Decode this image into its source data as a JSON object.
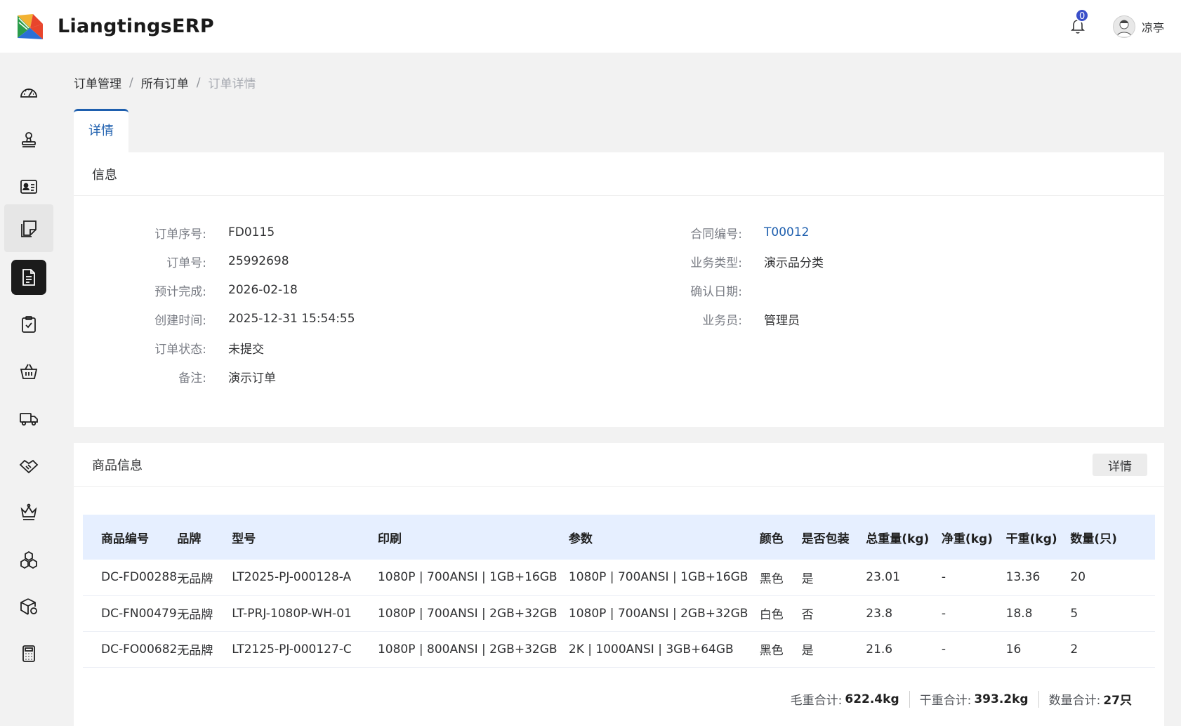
{
  "app": {
    "title": "LiangtingsERP"
  },
  "header": {
    "notification_count": "0",
    "username": "凉亭"
  },
  "breadcrumb": [
    "订单管理",
    "所有订单",
    "订单详情"
  ],
  "tabs": [
    {
      "label": "详情"
    }
  ],
  "info_card": {
    "title": "信息",
    "left": [
      {
        "label": "订单序号:",
        "value": "FD0115"
      },
      {
        "label": "订单号:",
        "value": "25992698"
      },
      {
        "label": "预计完成:",
        "value": "2026-02-18"
      },
      {
        "label": "创建时间:",
        "value": "2025-12-31 15:54:55"
      },
      {
        "label": "订单状态:",
        "value": "未提交"
      },
      {
        "label": "备注:",
        "value": "演示订单"
      }
    ],
    "right": [
      {
        "label": "合同编号:",
        "value": "T00012"
      },
      {
        "label": "业务类型:",
        "value": "演示品分类"
      },
      {
        "label": "确认日期:",
        "value": ""
      },
      {
        "label": "业务员:",
        "value": "管理员"
      }
    ]
  },
  "goods_card": {
    "title": "商品信息",
    "detail_button": "详情",
    "columns": [
      "商品编号",
      "品牌",
      "型号",
      "印刷",
      "参数",
      "颜色",
      "是否包装",
      "总重量(kg)",
      "净重(kg)",
      "干重(kg)",
      "数量(只)"
    ],
    "rows": [
      [
        "DC-FD00288",
        "无品牌",
        "LT2025-PJ-000128-A",
        "1080P | 700ANSI | 1GB+16GB",
        "1080P | 700ANSI | 1GB+16GB",
        "黑色",
        "是",
        "23.01",
        "-",
        "13.36",
        "20"
      ],
      [
        "DC-FN00479",
        "无品牌",
        "LT-PRJ-1080P-WH-01",
        "1080P | 700ANSI | 2GB+32GB",
        "1080P | 700ANSI | 2GB+32GB",
        "白色",
        "否",
        "23.8",
        "-",
        "18.8",
        "5"
      ],
      [
        "DC-FO00682",
        "无品牌",
        "LT2125-PJ-000127-C",
        "1080P | 800ANSI | 2GB+32GB",
        "2K | 1000ANSI | 3GB+64GB",
        "黑色",
        "是",
        "21.6",
        "-",
        "16",
        "2"
      ]
    ],
    "totals": [
      {
        "label": "毛重合计:",
        "value": "622.4kg"
      },
      {
        "label": "干重合计:",
        "value": "393.2kg"
      },
      {
        "label": "数量合计:",
        "value": "27只"
      }
    ]
  },
  "sidebar": {
    "items": [
      {
        "icon": "dashboard-icon"
      },
      {
        "icon": "stamp-icon"
      },
      {
        "icon": "contact-card-icon"
      },
      {
        "icon": "sticky-note-icon"
      },
      {
        "icon": "document-icon"
      },
      {
        "icon": "clipboard-check-icon"
      },
      {
        "icon": "basket-icon"
      },
      {
        "icon": "truck-icon"
      },
      {
        "icon": "handshake-icon"
      },
      {
        "icon": "crown-icon"
      },
      {
        "icon": "boxes-icon"
      },
      {
        "icon": "package-settings-icon"
      },
      {
        "icon": "calculator-icon"
      }
    ]
  }
}
